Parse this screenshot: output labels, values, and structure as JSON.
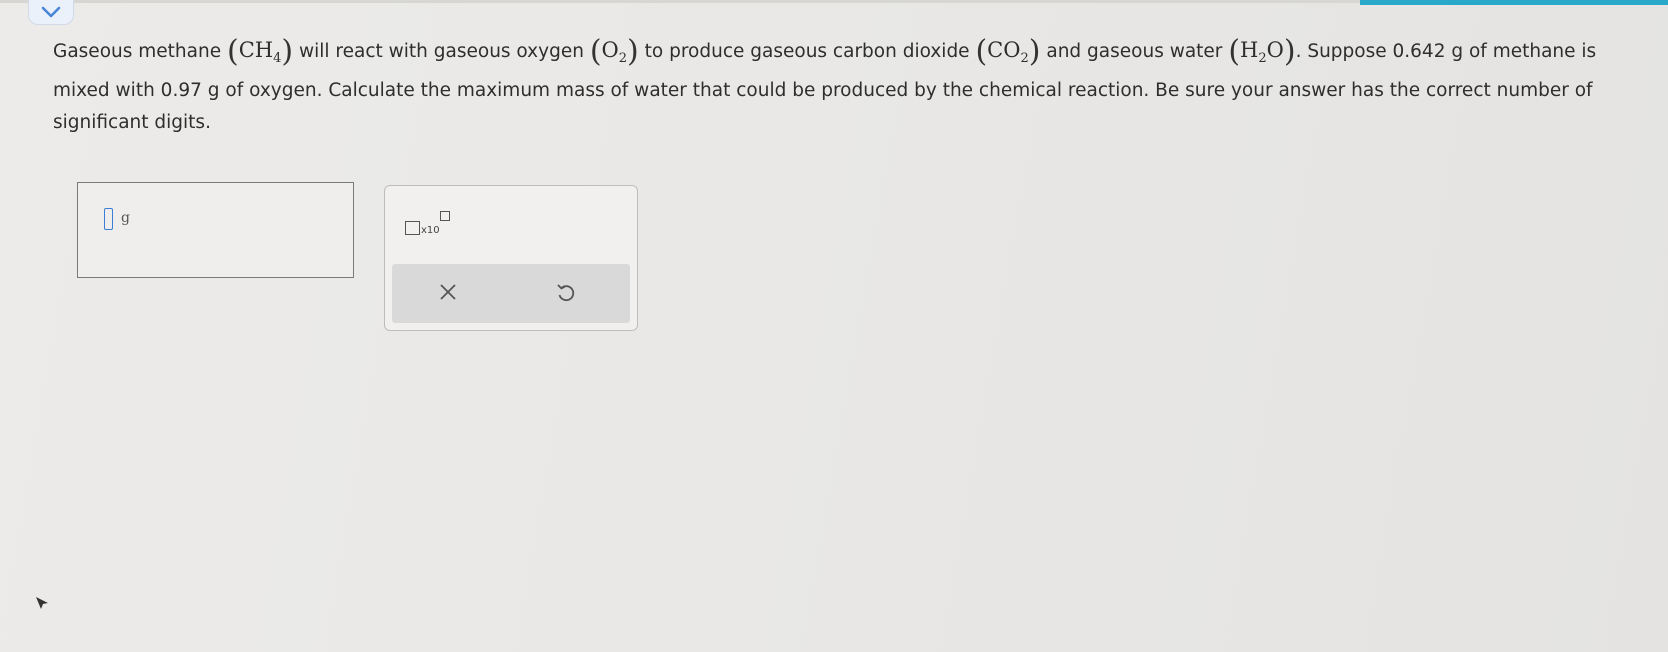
{
  "question": {
    "part1": "Gaseous methane",
    "f1_main": "CH",
    "f1_sub": "4",
    "part2": "will react with gaseous oxygen",
    "f2_main": "O",
    "f2_sub": "2",
    "part3": "to produce gaseous carbon dioxide",
    "f3_main": "CO",
    "f3_sub": "2",
    "part4": "and gaseous water",
    "f4_main_a": "H",
    "f4_sub": "2",
    "f4_main_b": "O",
    "part5": ". Suppose 0.642 g of methane is mixed with 0.97 g of oxygen. Calculate the maximum mass of water that could be produced by the chemical reaction. Be sure your answer has the correct number of significant digits."
  },
  "answer": {
    "value": "",
    "unit": "g"
  },
  "tools": {
    "sci_label": "x10"
  },
  "colors": {
    "accent": "#2aa8c9",
    "input_focus": "#3b7fd6",
    "chevron": "#4a86d8"
  },
  "icons": {
    "collapse": "chevron-down-icon",
    "clear": "x-icon",
    "undo": "undo-icon",
    "cursor": "mouse-pointer-icon"
  }
}
